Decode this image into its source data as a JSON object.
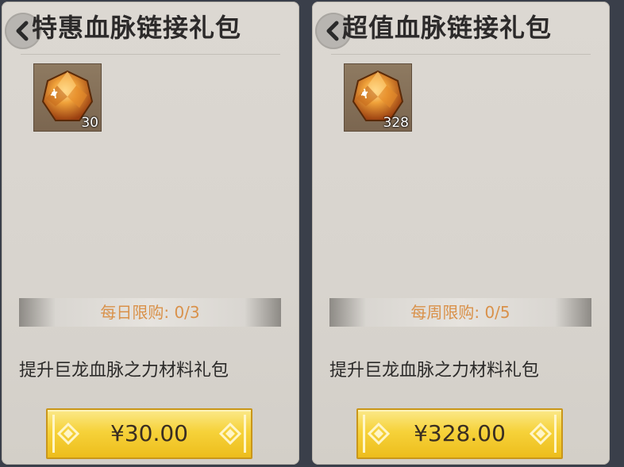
{
  "packs": [
    {
      "title": "特惠血脉链接礼包",
      "item_count": "30",
      "item_icon": "amber-gem-icon",
      "limit_text": "每日限购: 0/3",
      "description": "提升巨龙血脉之力材料礼包",
      "price": "¥30.00"
    },
    {
      "title": "超值血脉链接礼包",
      "item_count": "328",
      "item_icon": "amber-gem-icon",
      "limit_text": "每周限购: 0/5",
      "description": "提升巨龙血脉之力材料礼包",
      "price": "¥328.00"
    }
  ],
  "colors": {
    "limit_text": "#d9914a",
    "button_gold": "#f6d23a",
    "card_bg": "#dcd8d2"
  }
}
